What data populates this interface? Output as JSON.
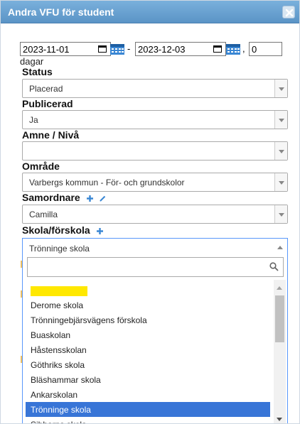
{
  "dialog": {
    "title": "Andra VFU för student",
    "close_icon": "close-icon"
  },
  "dates": {
    "start": "2023-11-01",
    "separator": "-",
    "end": "2023-12-03",
    "comma": ",",
    "days_value": "0",
    "days_label": "dagar"
  },
  "fields": {
    "status": {
      "label": "Status",
      "value": "Placerad"
    },
    "publicerad": {
      "label": "Publicerad",
      "value": "Ja"
    },
    "amne": {
      "label": "Amne / Nivå",
      "value": ""
    },
    "omrade": {
      "label": "Område",
      "value": "Varbergs kommun - För- och grundskolor"
    },
    "samordnare": {
      "label": "Samordnare",
      "value": "Camilla"
    },
    "skola": {
      "label": "Skola/förskola",
      "value": "Trönninge skola",
      "search_value": "",
      "options": [
        "",
        "Derome skola",
        "Trönningebjärsvägens förskola",
        "Buaskolan",
        "Håstensskolan",
        "Göthriks skola",
        "Bläshammar skola",
        "Ankarskolan",
        "Trönninge skola",
        "Sibbarps skola"
      ],
      "highlighted_index": 8
    }
  },
  "colors": {
    "titlebar": "#6aa2d3",
    "highlight": "#3875d7",
    "accent_icon": "#3a87d4",
    "redacted_mark": "#ffe800"
  }
}
